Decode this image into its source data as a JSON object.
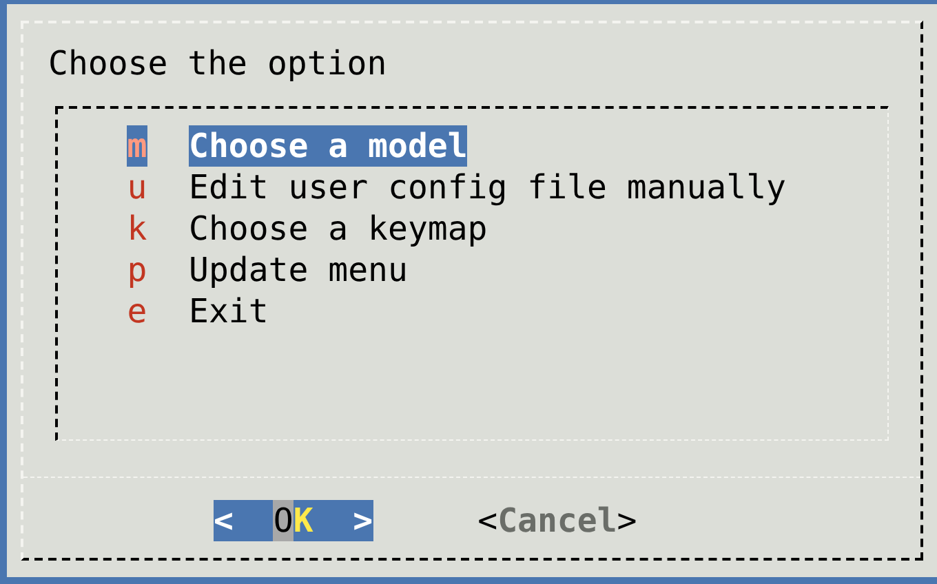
{
  "dialog": {
    "title": "Choose the option",
    "items": [
      {
        "tag": "m",
        "label": "Choose a model",
        "selected": true
      },
      {
        "tag": "u",
        "label": "Edit user config file manually",
        "selected": false
      },
      {
        "tag": "k",
        "label": "Choose a keymap",
        "selected": false
      },
      {
        "tag": "p",
        "label": "Update menu",
        "selected": false
      },
      {
        "tag": "e",
        "label": "Exit",
        "selected": false
      }
    ],
    "buttons": [
      {
        "left": "<",
        "label": "OK",
        "right": ">",
        "selected": true
      },
      {
        "left": "<",
        "label": "Cancel",
        "right": ">",
        "selected": false
      }
    ]
  }
}
